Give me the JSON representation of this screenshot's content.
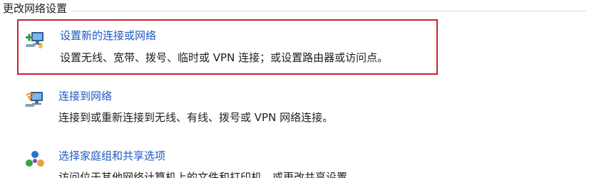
{
  "section": {
    "title": "更改网络设置"
  },
  "tasks": [
    {
      "icon": "new-connection-icon",
      "link": "设置新的连接或网络",
      "description": "设置无线、宽带、拨号、临时或 VPN 连接；或设置路由器或访问点。",
      "highlighted": true
    },
    {
      "icon": "connect-network-icon",
      "link": "连接到网络",
      "description": "连接到或重新连接到无线、有线、拨号或 VPN 网络连接。",
      "highlighted": false
    },
    {
      "icon": "homegroup-icon",
      "link": "选择家庭组和共享选项",
      "description": "访问位于其他网络计算机上的文件和打印机，或更改共享设置。",
      "highlighted": false
    }
  ],
  "colors": {
    "link": "#1f57c3",
    "highlight_border": "#c8202f",
    "text": "#1e1e1e"
  }
}
